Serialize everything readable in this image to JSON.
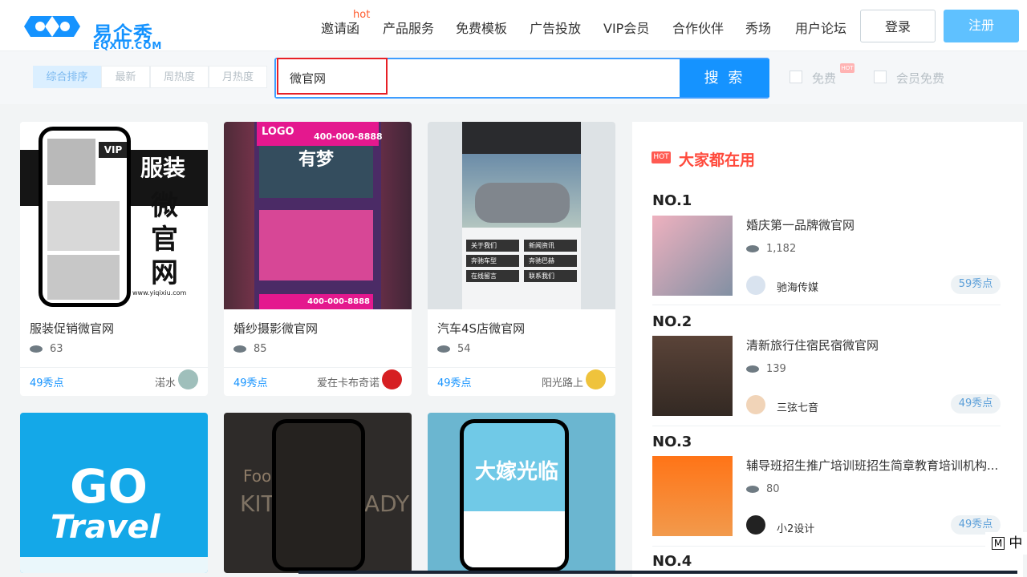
{
  "header": {
    "brand": "易企秀",
    "brand_sub": "EQXIU.COM",
    "hot_badge": "hot",
    "nav": [
      "邀请函",
      "产品服务",
      "免费模板",
      "广告投放",
      "VIP会员",
      "合作伙伴",
      "秀场",
      "用户论坛"
    ],
    "login": "登录",
    "register": "注册"
  },
  "filters": {
    "sort": [
      "综合排序",
      "最新",
      "周热度",
      "月热度"
    ],
    "search_value": "微官网",
    "search_button": "搜 索",
    "free": "免费",
    "free_badge": "HOT",
    "member_free": "会员免费"
  },
  "cards": [
    {
      "title": "服装促销微官网",
      "views": "63",
      "price": "49秀点",
      "author": "渃水"
    },
    {
      "title": "婚纱摄影微官网",
      "views": "85",
      "price": "49秀点",
      "author": "爱在卡布奇诺"
    },
    {
      "title": "汽车4S店微官网",
      "views": "54",
      "price": "49秀点",
      "author": "阳光路上"
    }
  ],
  "thumb_text": {
    "vip": "VIP",
    "clothing": "服装",
    "vertical": "微官网",
    "url": "www.yiqixiu.com",
    "logo": "LOGO",
    "contact": "CONTACT US:",
    "phone": "400-000-8888",
    "dream": "有梦",
    "car_buttons": [
      "关于我们",
      "新闻资讯",
      "奔驰车型",
      "奔驰巴赫",
      "在线留言",
      "联系我们"
    ],
    "go": "GO",
    "travel": "Travel",
    "food": "Food",
    "kitchen": "KIT",
    "lady": "ADY",
    "big_sale": "大嫁光临"
  },
  "ranking": {
    "hot": "HOT",
    "title": "大家都在用",
    "items": [
      {
        "no": "NO.1",
        "name": "婚庆第一品牌微官网",
        "views": "1,182",
        "author": "驰海传媒",
        "price": "59秀点"
      },
      {
        "no": "NO.2",
        "name": "清新旅行住宿民宿微官网",
        "views": "139",
        "author": "三弦七音",
        "price": "49秀点"
      },
      {
        "no": "NO.3",
        "name": "辅导班招生推广培训班招生简章教育培训机构...",
        "views": "80",
        "author": "小2设计",
        "price": "49秀点"
      },
      {
        "no": "NO.4"
      }
    ]
  },
  "side_tab": "中",
  "colors": {
    "brand": "#1593ff",
    "accent": "#5fc1ff",
    "hot": "#ff4a3c"
  }
}
